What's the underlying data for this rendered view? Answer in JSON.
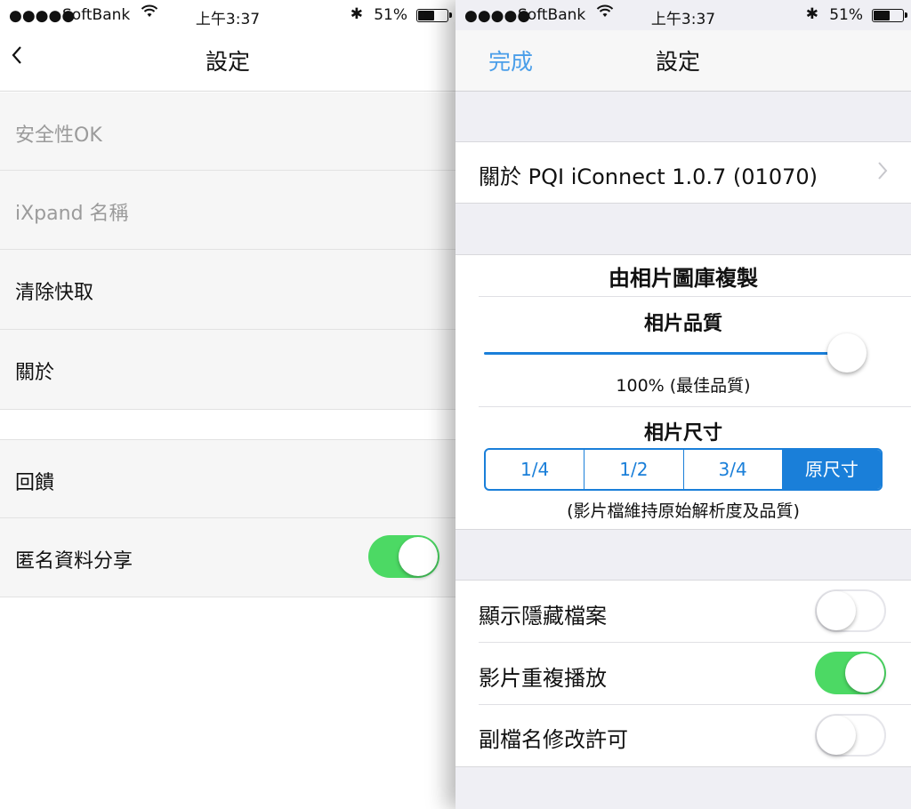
{
  "status": {
    "carrier": "SoftBank",
    "signal": "●●●●●",
    "time": "上午3:37",
    "battery": "51%",
    "bluetooth": "✱",
    "wifi": "wifi-icon"
  },
  "left": {
    "title": "設定",
    "back_icon": "chevron-left-icon",
    "items": [
      {
        "label": "安全性OK"
      },
      {
        "label": "iXpand 名稱"
      },
      {
        "label": "清除快取"
      },
      {
        "label": "關於"
      },
      {
        "label": "回饋"
      },
      {
        "label": "匿名資料分享",
        "toggle": true
      }
    ]
  },
  "right": {
    "done": "完成",
    "title": "設定",
    "about": "關於 PQI iConnect 1.0.7 (01070)",
    "copy_header": "由相片圖庫複製",
    "quality_label": "相片品質",
    "quality_value": 1.0,
    "quality_text": "100% (最佳品質)",
    "size_label": "相片尺寸",
    "size_options": [
      "1/4",
      "1/2",
      "3/4",
      "原尺寸"
    ],
    "size_selected": "原尺寸",
    "size_note": "(影片檔維持原始解析度及品質)",
    "toggles": [
      {
        "label": "顯示隱藏檔案",
        "on": false
      },
      {
        "label": "影片重複播放",
        "on": true
      },
      {
        "label": "副檔名修改許可",
        "on": false
      }
    ]
  },
  "colors": {
    "accent": "#1a7fd9",
    "toggle_on": "#4cd964",
    "done": "#4a9ee9"
  }
}
